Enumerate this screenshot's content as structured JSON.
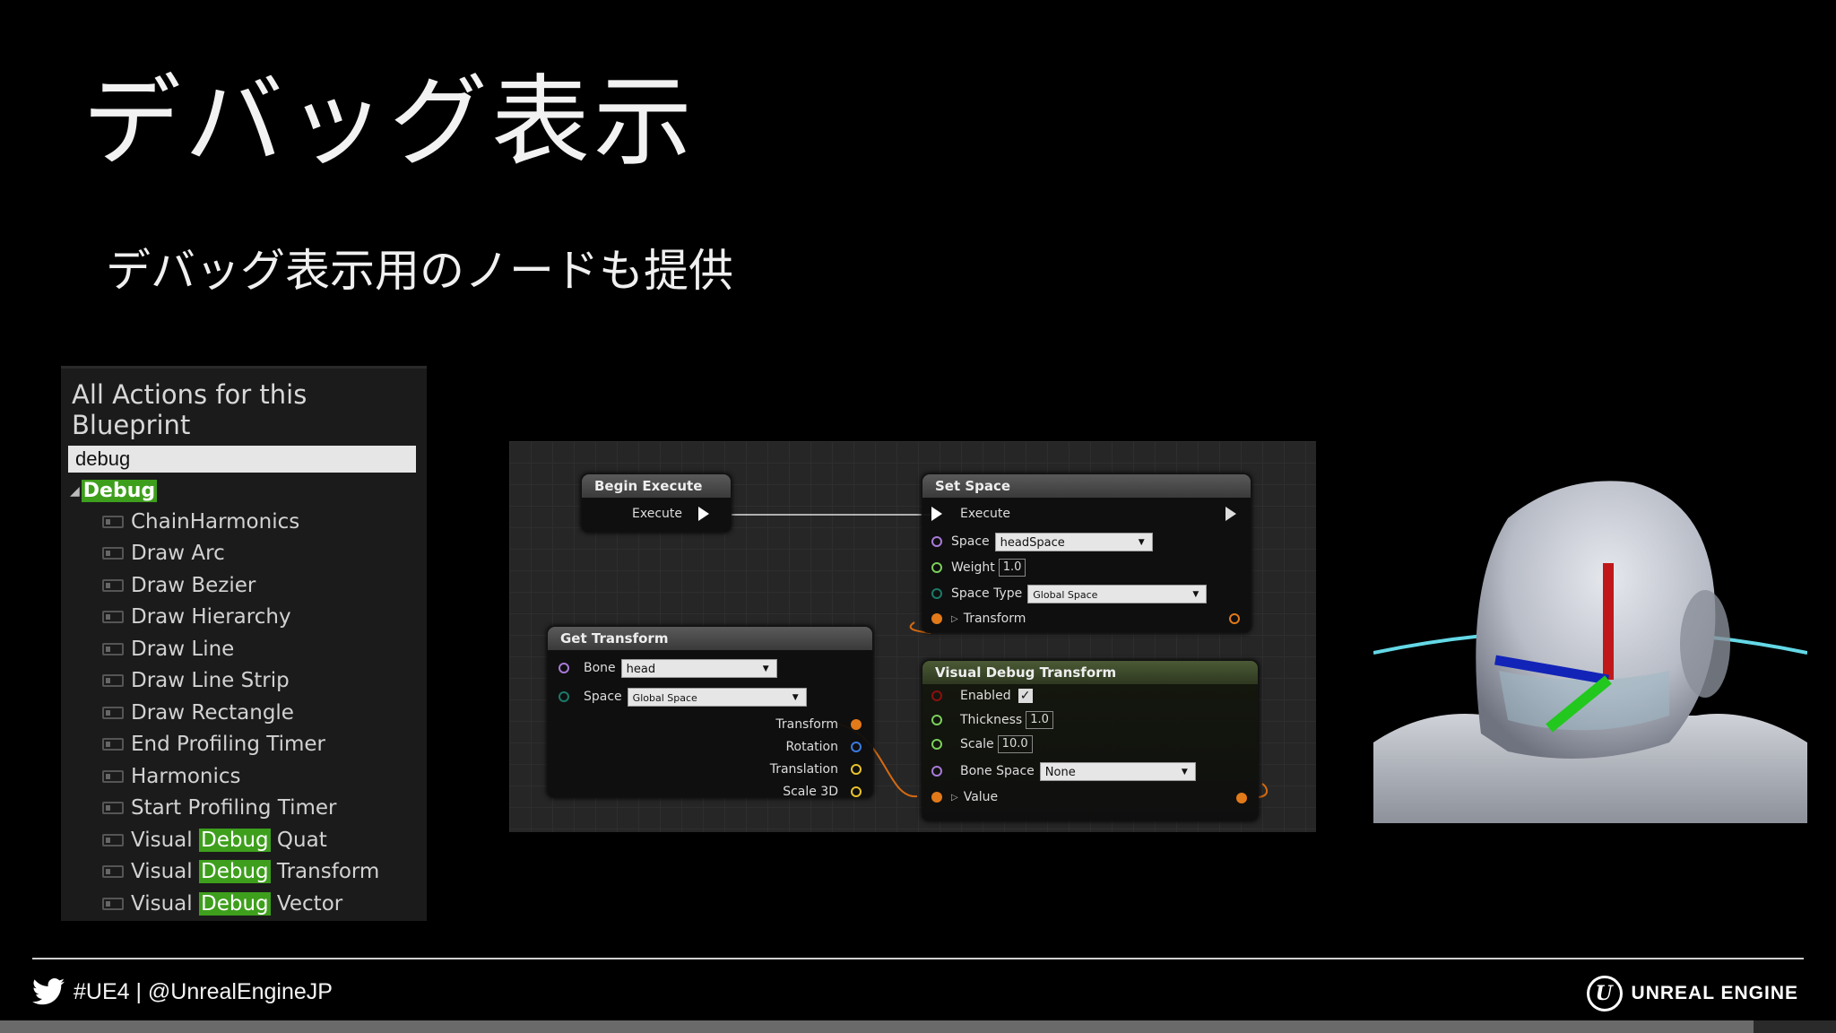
{
  "slide": {
    "title": "デバッグ表示",
    "subtitle": "デバッグ表示用のノードも提供"
  },
  "actions_panel": {
    "header": "All Actions for this Blueprint",
    "search_value": "debug",
    "category": "Debug",
    "items": [
      {
        "pre": "ChainHarmonics",
        "hl": "",
        "post": ""
      },
      {
        "pre": "Draw Arc",
        "hl": "",
        "post": ""
      },
      {
        "pre": "Draw Bezier",
        "hl": "",
        "post": ""
      },
      {
        "pre": "Draw Hierarchy",
        "hl": "",
        "post": ""
      },
      {
        "pre": "Draw Line",
        "hl": "",
        "post": ""
      },
      {
        "pre": "Draw Line Strip",
        "hl": "",
        "post": ""
      },
      {
        "pre": "Draw Rectangle",
        "hl": "",
        "post": ""
      },
      {
        "pre": "End Profiling Timer",
        "hl": "",
        "post": ""
      },
      {
        "pre": "Harmonics",
        "hl": "",
        "post": ""
      },
      {
        "pre": "Start Profiling Timer",
        "hl": "",
        "post": ""
      },
      {
        "pre": "Visual ",
        "hl": "Debug",
        "post": " Quat"
      },
      {
        "pre": "Visual ",
        "hl": "Debug",
        "post": " Transform"
      },
      {
        "pre": "Visual ",
        "hl": "Debug",
        "post": " Vector"
      }
    ],
    "highlight_color": "#3e9f1d"
  },
  "graph": {
    "begin_execute": {
      "title": "Begin Execute",
      "execute": "Execute"
    },
    "set_space": {
      "title": "Set Space",
      "execute": "Execute",
      "space_label": "Space",
      "space_value": "headSpace",
      "weight_label": "Weight",
      "weight_value": "1.0",
      "space_type_label": "Space Type",
      "space_type_value": "Global Space",
      "transform_label": "Transform"
    },
    "get_transform": {
      "title": "Get Transform",
      "bone_label": "Bone",
      "bone_value": "head",
      "space_label": "Space",
      "space_value": "Global Space",
      "outputs": [
        "Transform",
        "Rotation",
        "Translation",
        "Scale 3D"
      ]
    },
    "visual_debug_transform": {
      "title": "Visual Debug Transform",
      "enabled_label": "Enabled",
      "thickness_label": "Thickness",
      "thickness_value": "1.0",
      "scale_label": "Scale",
      "scale_value": "10.0",
      "bone_space_label": "Bone Space",
      "bone_space_value": "None",
      "value_label": "Value"
    }
  },
  "footer": {
    "social": "#UE4 | @UnrealEngineJP",
    "brand": "UNREAL ENGINE",
    "progress": 0.955
  }
}
